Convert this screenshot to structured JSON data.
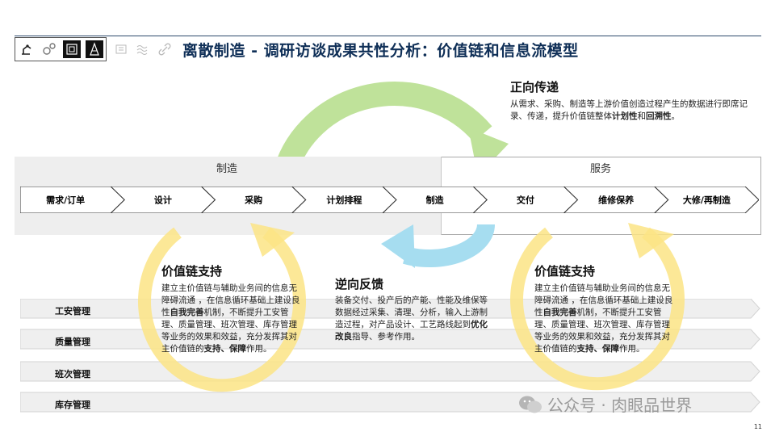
{
  "title": {
    "main": "离散制造 - 调研访谈成果共性分析：",
    "bold_tail": "价值链和信息流模型"
  },
  "header_icons": [
    "robot-arm-icon",
    "gears-icon",
    "circuit-board-icon",
    "tower-icon"
  ],
  "header_icons_faded": [
    "gadget-icon",
    "waves-icon",
    "link-icon"
  ],
  "segments": {
    "left": "制造",
    "right": "服务"
  },
  "stages": [
    "需求/订单",
    "设计",
    "采购",
    "计划排程",
    "制造",
    "交付",
    "维修保养",
    "大修/再制造"
  ],
  "forward": {
    "heading": "正向传递",
    "text_1": "从需求、采购、制造等上游价值创造过程产生的数据进行即席记录、传递，提升价值链整体",
    "bold_1": "计划性",
    "text_2": "和",
    "bold_2": "回溯性",
    "text_3": "。"
  },
  "backward": {
    "heading": "逆向反馈",
    "text_1": "装备交付、投产后的产能、性能及维保等数据经过采集、清理、分析，输入上游制造过程，对产品设计、工艺路线起到",
    "bold_1": "优化改良",
    "text_2": "指导、参考作用。"
  },
  "support_left": {
    "heading": "价值链支持",
    "text_1": "建立主价值链与辅助业务间的信息无障碍流通 ，在信息循环基础上建设良性",
    "bold_1": "自我完善",
    "text_2": "机制，不断提升工安管理、质量管理、班次管理、库存管理等业务的效果和效益，充分发挥其对主价值链的",
    "bold_2": "支持、保障",
    "text_3": "作用。"
  },
  "support_right": {
    "heading": "价值链支持",
    "text_1": "建立主价值链与辅助业务间的信息无障碍流通 ，在信息循环基础上建设良性",
    "bold_1": "自我完善",
    "text_2": "机制，不断提升工安管理、质量管理、班次管理、库存管理等业务的效果和效益，充分发挥其对主价值链的",
    "bold_2": "支持、保障",
    "text_3": "作用。"
  },
  "support_bars": [
    "工安管理",
    "质量管理",
    "班次管理",
    "库存管理"
  ],
  "watermark": "公众号 · 肉眼品世界",
  "page_number": "11",
  "colors": {
    "title": "#0f2f57",
    "green_arrow": "#bfe29a",
    "blue_arrow": "#a6ddf0",
    "yellow_arrow": "#fbe485"
  }
}
